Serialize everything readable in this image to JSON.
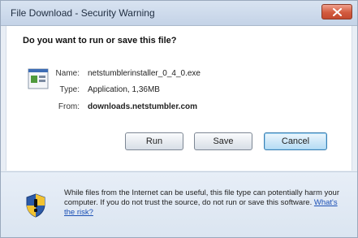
{
  "window": {
    "title": "File Download - Security Warning"
  },
  "dialog": {
    "question": "Do you want to run or save this file?",
    "name_label": "Name:",
    "name_value": "netstumblerinstaller_0_4_0.exe",
    "type_label": "Type:",
    "type_value": "Application, 1,36MB",
    "from_label": "From:",
    "from_value": "downloads.netstumbler.com"
  },
  "buttons": {
    "run": "Run",
    "save": "Save",
    "cancel": "Cancel"
  },
  "warning": {
    "text": "While files from the Internet can be useful, this file type can potentially harm your computer. If you do not trust the source, do not run or save this software.",
    "link": "What's the risk?"
  },
  "colors": {
    "close_button": "#d25b3f",
    "link": "#1a4fb5",
    "shield_yellow": "#f2c230",
    "shield_blue": "#2c5aa8"
  }
}
